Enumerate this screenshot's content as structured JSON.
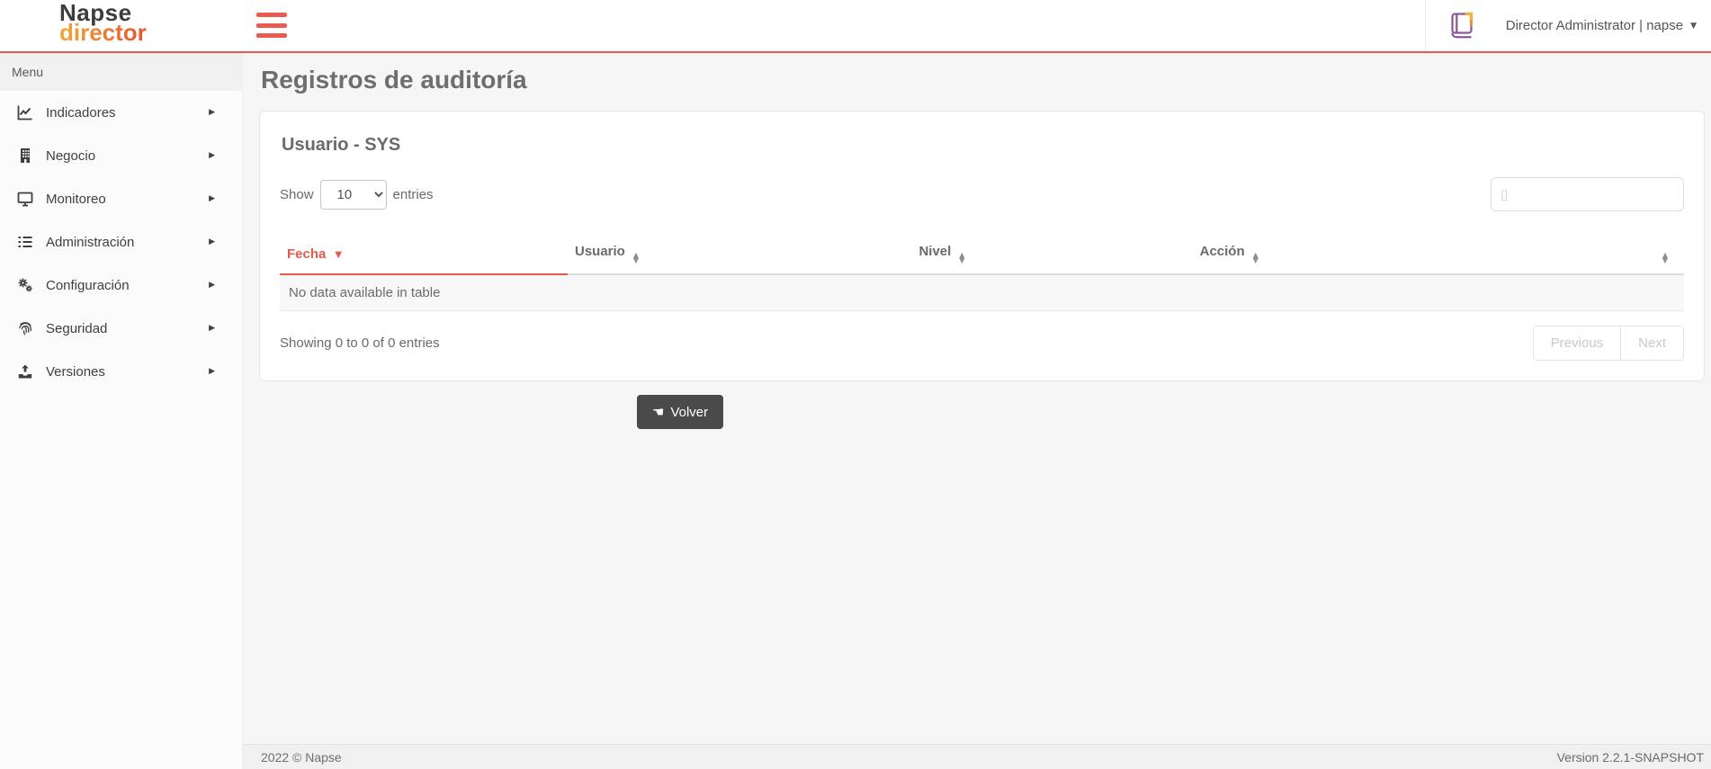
{
  "header": {
    "logo": {
      "line1": "Napse",
      "line2": "director"
    },
    "user_menu_label": "Director Administrator | napse"
  },
  "sidebar": {
    "menu_label": "Menu",
    "items": [
      {
        "label": "Indicadores",
        "icon": "chart-line-icon"
      },
      {
        "label": "Negocio",
        "icon": "building-icon"
      },
      {
        "label": "Monitoreo",
        "icon": "monitor-icon"
      },
      {
        "label": "Administración",
        "icon": "list-icon"
      },
      {
        "label": "Configuración",
        "icon": "gears-icon"
      },
      {
        "label": "Seguridad",
        "icon": "fingerprint-icon"
      },
      {
        "label": "Versiones",
        "icon": "upload-icon"
      }
    ]
  },
  "page": {
    "title": "Registros de auditoría"
  },
  "card": {
    "title": "Usuario - SYS",
    "length_control": {
      "show_label": "Show",
      "selected_value": "10",
      "entries_label": "entries"
    },
    "search": {
      "placeholder": "▯"
    },
    "table": {
      "columns": [
        {
          "label": "Fecha",
          "sort": "desc"
        },
        {
          "label": "Usuario",
          "sort": "none"
        },
        {
          "label": "Nivel",
          "sort": "none"
        },
        {
          "label": "Acción",
          "sort": "none"
        },
        {
          "label": "",
          "sort": "none"
        }
      ],
      "empty_message": "No data available in table"
    },
    "info_text": "Showing 0 to 0 of 0 entries",
    "pagination": {
      "previous_label": "Previous",
      "next_label": "Next"
    }
  },
  "actions": {
    "volver_label": "Volver"
  },
  "footer": {
    "copyright": "2022 © Napse",
    "version": "Version 2.2.1-SNAPSHOT"
  },
  "colors": {
    "accent_red": "#e65a4d",
    "logo_gradient_start": "#f2a73b",
    "logo_gradient_end": "#e8542f",
    "book_icon_purple": "#8a5a96",
    "book_icon_yellow": "#f2b544",
    "volver_button_bg": "#4a4a4a"
  }
}
